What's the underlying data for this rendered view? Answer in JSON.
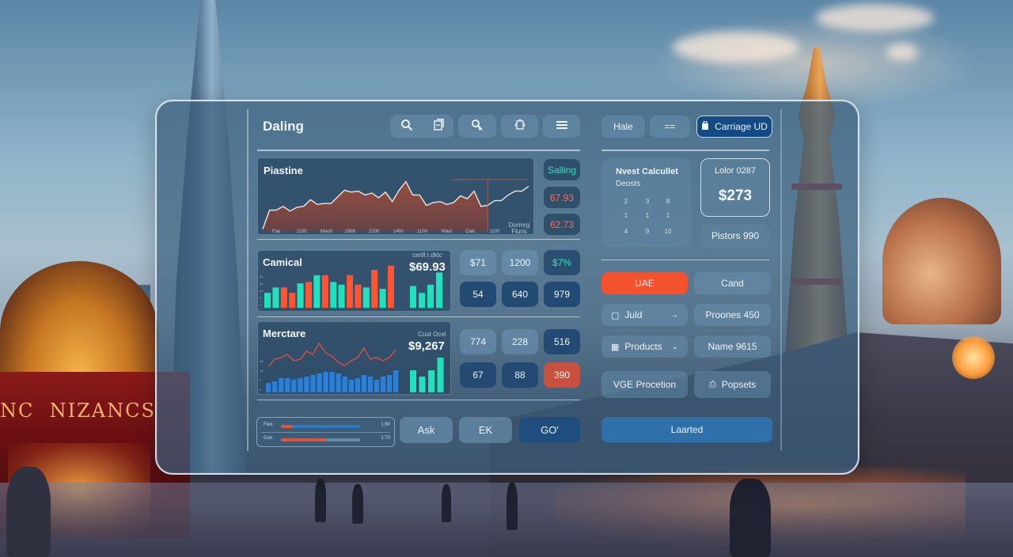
{
  "header": {
    "title": "Daling",
    "toolbar_icons": [
      "search-icon",
      "document-icon",
      "key-icon",
      "puzzle-icon",
      "menu-icon"
    ]
  },
  "main_chart": {
    "title": "Piastine",
    "badges": {
      "top": "Salling",
      "middle": "67.93",
      "bottom": "62.73"
    },
    "x_tick_labels": [
      "Fae",
      "1150",
      "Mand",
      "1998",
      "2100",
      "1460",
      "1100",
      "Wael",
      "Oaki",
      "1100"
    ],
    "corner_note": "Dormrg Fluns",
    "colors": {
      "line": "#f4e3da",
      "area": "#8a4a3e",
      "badge_teal": "#39e0b8",
      "badge_red": "#ff6a5a"
    }
  },
  "chart_data": [
    {
      "type": "area",
      "title": "Piastine",
      "xlabel": "",
      "ylabel": "",
      "x_tick_labels": [
        "Fae",
        "1150",
        "Mand",
        "1998",
        "2100",
        "1460",
        "1100",
        "Wael",
        "Oaki",
        "1100"
      ],
      "values": [
        2,
        22,
        22,
        26,
        21,
        25,
        26,
        33,
        28,
        29,
        29,
        36,
        43,
        41,
        42,
        38,
        40,
        35,
        41,
        31,
        43,
        52,
        38,
        38,
        27,
        30,
        31,
        28,
        30,
        37,
        34,
        42,
        26,
        27,
        32,
        32,
        38,
        42,
        42,
        47
      ],
      "ylim": [
        0,
        60
      ],
      "grid": false
    },
    {
      "type": "bar",
      "title": "Camical",
      "subtitle": "cerill.r.dktc",
      "headline_value": "$69.93",
      "series": [
        {
          "name": "teal",
          "color": "#21e0bc"
        },
        {
          "name": "red",
          "color": "#ff5533"
        }
      ],
      "values": [
        11,
        15,
        15,
        11,
        18,
        19,
        24,
        24,
        19,
        17,
        24,
        17,
        15,
        28,
        14,
        31
      ],
      "colors": [
        "teal",
        "teal",
        "red",
        "red",
        "teal",
        "red",
        "teal",
        "red",
        "teal",
        "teal",
        "red",
        "red",
        "teal",
        "red",
        "teal",
        "red"
      ],
      "side_bars": [
        16,
        11,
        17,
        26
      ],
      "ylim": [
        0,
        35
      ]
    },
    {
      "type": "bar",
      "title": "Merctare",
      "subtitle": "Cuut Ocel",
      "headline_value": "$9,267",
      "bar_values": [
        6,
        7,
        9,
        9,
        8,
        9,
        10,
        11,
        12,
        13,
        13,
        12,
        10,
        8,
        9,
        11,
        10,
        8,
        10,
        11,
        14
      ],
      "line_values": [
        16,
        21,
        22,
        24,
        20,
        21,
        26,
        24,
        31,
        25,
        23,
        19,
        17,
        20,
        22,
        28,
        21,
        22,
        20,
        22,
        27
      ],
      "side_bars": [
        14,
        10,
        14,
        22
      ],
      "ylim": [
        0,
        35
      ]
    }
  ],
  "camical_tiles": [
    "$71",
    "1200",
    "$7%",
    "54",
    "640",
    "979"
  ],
  "merctare_tiles": [
    "774",
    "228",
    "516",
    "67",
    "88",
    "390"
  ],
  "progress": [
    {
      "label": "Fliet",
      "fraction": 0.15,
      "value": "1:60"
    },
    {
      "label": "Gun",
      "fraction": 0.57,
      "value": "1:70"
    }
  ],
  "actions": {
    "ask": "Ask",
    "ek": "EK",
    "go": "GO'"
  },
  "right": {
    "top_buttons": {
      "male": "Hale",
      "list_icon": "==",
      "primary": "Carriage UD"
    },
    "calc": {
      "title": "Nvest Calcullet",
      "subtitle": "Deosts",
      "keys": [
        "2",
        "3",
        "8",
        "1",
        "1",
        "1",
        "4",
        "9",
        "10"
      ]
    },
    "color_card": {
      "label": "Lolor 0287",
      "value": "$273"
    },
    "filters": "Pistors 990",
    "buttons": {
      "uae": "UAE",
      "cand": "Cand",
      "add": "Juld",
      "proones": "Proones 450",
      "products": "Products",
      "name": "Name 9615",
      "vge": "VGE Procetion",
      "popsets": "Popsets",
      "loaded": "Laarted"
    }
  }
}
